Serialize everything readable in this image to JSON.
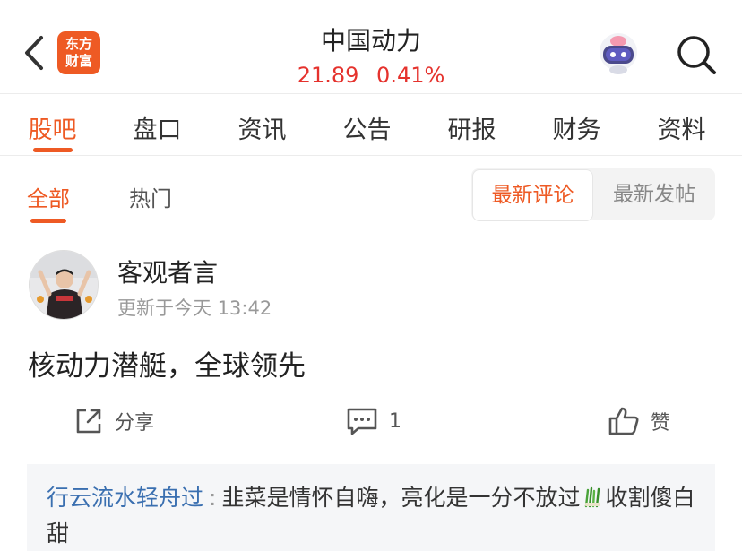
{
  "header": {
    "logo_line1": "东方",
    "logo_line2": "财富",
    "title": "中国动力",
    "price": "21.89",
    "change": "0.41%"
  },
  "tabs": [
    {
      "label": "股吧",
      "active": true
    },
    {
      "label": "盘口",
      "active": false
    },
    {
      "label": "资讯",
      "active": false
    },
    {
      "label": "公告",
      "active": false
    },
    {
      "label": "研报",
      "active": false
    },
    {
      "label": "财务",
      "active": false
    },
    {
      "label": "资料",
      "active": false
    }
  ],
  "subtabs": {
    "all": "全部",
    "hot": "热门",
    "latest_comment": "最新评论",
    "latest_post": "最新发帖"
  },
  "post": {
    "author": "客观者言",
    "time": "更新于今天 13:42",
    "content": "核动力潜艇，全球领先",
    "share_label": "分享",
    "comment_count": "1",
    "like_label": "赞"
  },
  "comment": {
    "user": "行云流水轻舟过",
    "colon": ":",
    "text_before_emoji": "韭菜是情怀自嗨，亮化是一分不放过",
    "text_after_emoji": "收割傻白甜"
  },
  "colors": {
    "accent": "#ee5a24",
    "price_red": "#e5322d",
    "comment_user": "#3a6fb0"
  }
}
